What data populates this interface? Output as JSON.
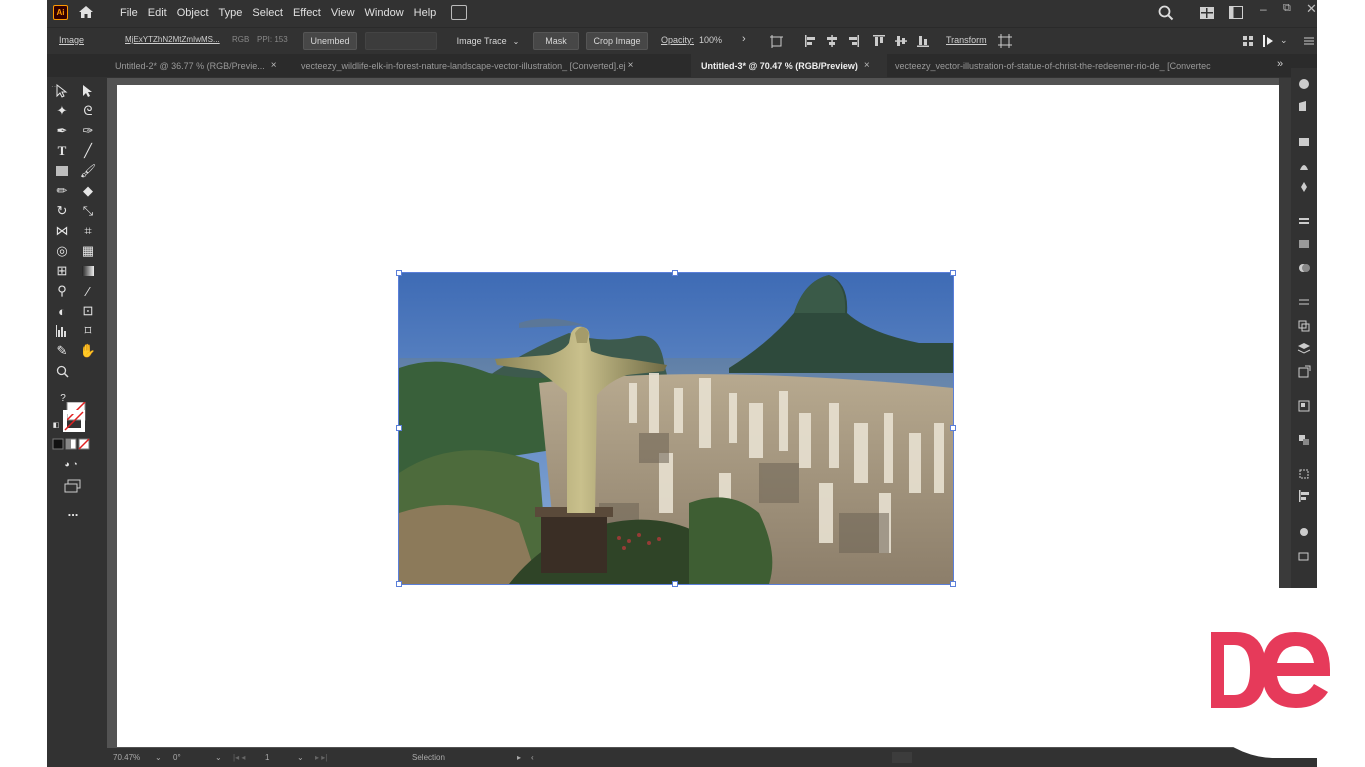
{
  "app": {
    "logo_text": "Ai"
  },
  "menu": [
    "File",
    "Edit",
    "Object",
    "Type",
    "Select",
    "Effect",
    "View",
    "Window",
    "Help"
  ],
  "control_bar": {
    "object_type": "Image",
    "file_name": "MjExYTZhN2MtZmIwMS...",
    "color_mode": "RGB",
    "ppi": "PPI: 153",
    "embed_button": "Unembed",
    "image_trace_button": "Image Trace",
    "mask_button": "Mask",
    "crop_button": "Crop Image",
    "opacity_label": "Opacity:",
    "opacity_value": "100%",
    "transform_button": "Transform"
  },
  "tabs": [
    {
      "label": "Untitled-2* @ 36.77 % (RGB/Previe...",
      "active": false
    },
    {
      "label": "vecteezy_wildlife-elk-in-forest-nature-landscape-vector-illustration_ [Converted].ej",
      "active": false
    },
    {
      "label": "Untitled-3* @ 70.47 % (RGB/Preview)",
      "active": true
    },
    {
      "label": "vecteezy_vector-illustration-of-statue-of-christ-the-redeemer-rio-de_ [Convertec",
      "active": false
    }
  ],
  "tools": {
    "question_mark": "?",
    "more_label": "..."
  },
  "status_bar": {
    "zoom": "70.47%",
    "rotation": "0°",
    "artboard_number": "1",
    "tool_name": "Selection"
  },
  "colors": {
    "accent_selection": "#5b7fd9",
    "brand_logo": "#e63a5a",
    "ui_dark": "#323232"
  }
}
